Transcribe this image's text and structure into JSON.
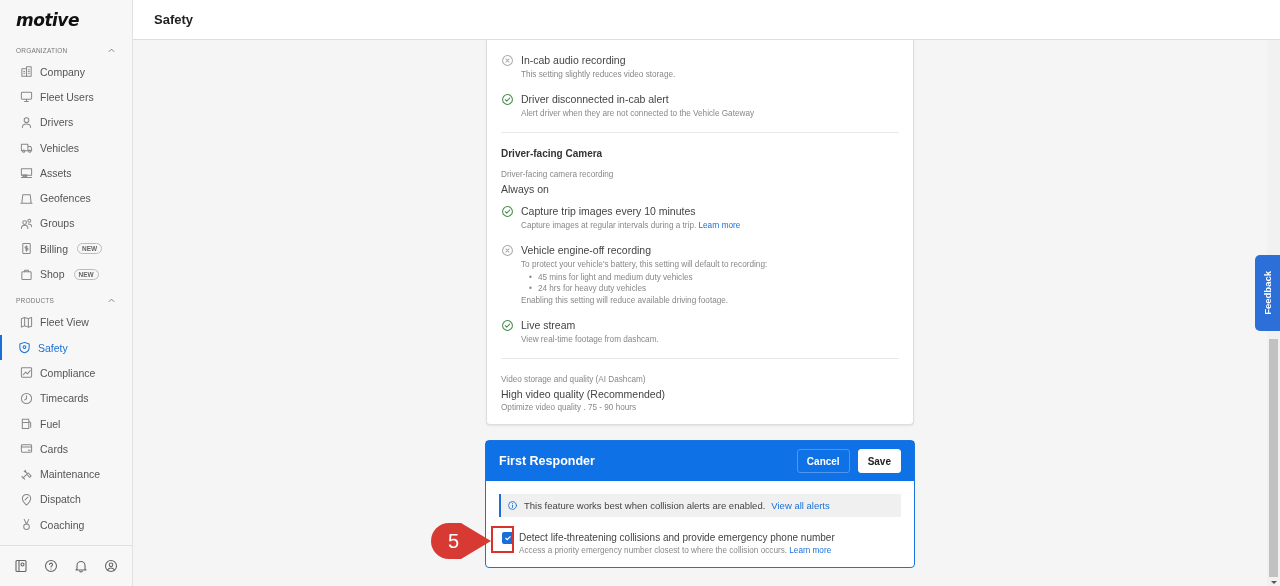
{
  "sidebar": {
    "logo": "motive",
    "sections": [
      {
        "title": "ORGANIZATION",
        "expanded": true,
        "items": [
          {
            "label": "Company",
            "selected": false
          },
          {
            "label": "Fleet Users",
            "selected": false
          },
          {
            "label": "Drivers",
            "selected": false
          },
          {
            "label": "Vehicles",
            "selected": false
          },
          {
            "label": "Assets",
            "selected": false
          },
          {
            "label": "Geofences",
            "selected": false
          },
          {
            "label": "Groups",
            "selected": false
          },
          {
            "label": "Billing",
            "badge": "NEW",
            "selected": false
          },
          {
            "label": "Shop",
            "badge": "NEW",
            "selected": false
          }
        ]
      },
      {
        "title": "PRODUCTS",
        "expanded": true,
        "items": [
          {
            "label": "Fleet View",
            "selected": false
          },
          {
            "label": "Safety",
            "selected": true
          },
          {
            "label": "Compliance",
            "selected": false
          },
          {
            "label": "Timecards",
            "selected": false
          },
          {
            "label": "Fuel",
            "selected": false
          },
          {
            "label": "Cards",
            "selected": false
          },
          {
            "label": "Maintenance",
            "selected": false
          },
          {
            "label": "Dispatch",
            "selected": false
          },
          {
            "label": "Coaching",
            "selected": false
          }
        ]
      }
    ]
  },
  "header": {
    "title": "Safety"
  },
  "settings_card": {
    "items": [
      {
        "kind": "toggle_item",
        "label": "In-cab audio recording",
        "enabled": false,
        "description": "This setting slightly reduces video storage."
      },
      {
        "kind": "toggle_item",
        "label": "Driver disconnected in-cab alert",
        "enabled": true,
        "description": "Alert driver when they are not connected to the Vehicle Gateway"
      },
      {
        "kind": "divider"
      },
      {
        "kind": "heading",
        "text": "Driver-facing Camera"
      },
      {
        "kind": "field",
        "label": "Driver-facing camera recording",
        "value": "Always on"
      },
      {
        "kind": "toggle_item",
        "label": "Capture trip images every 10 minutes",
        "enabled": true,
        "description": "Capture images at regular intervals during a trip.",
        "link": "Learn more"
      },
      {
        "kind": "toggle_item",
        "label": "Vehicle engine-off recording",
        "enabled": false,
        "description": "To protect your vehicle's battery, this setting will default to recording:",
        "bullet_marker": "•",
        "bullets": [
          "45 mins for light and medium duty vehicles",
          "24 hrs for heavy duty vehicles"
        ],
        "note": "Enabling this setting will reduce available driving footage."
      },
      {
        "kind": "toggle_item",
        "label": "Live stream",
        "enabled": true,
        "description": "View real-time footage from dashcam."
      },
      {
        "kind": "divider"
      },
      {
        "kind": "field",
        "label": "Video storage and quality (AI Dashcam)",
        "value": "High video quality (Recommended)",
        "note": "Optimize video quality . 75 - 90 hours"
      }
    ]
  },
  "first_responder": {
    "title": "First Responder",
    "buttons": [
      "Cancel",
      "Save"
    ],
    "info": {
      "text": "This feature works best when collision alerts are enabled.",
      "link": "View all alerts"
    },
    "option": {
      "checked": true,
      "label": "Detect life-threatening collisions and provide emergency phone number",
      "description": "Access a priority emergency number closest to where the collision occurs.",
      "link": "Learn more"
    },
    "annotation": {
      "number": "5"
    }
  },
  "feedback_tab": {
    "label": "Feedback"
  }
}
